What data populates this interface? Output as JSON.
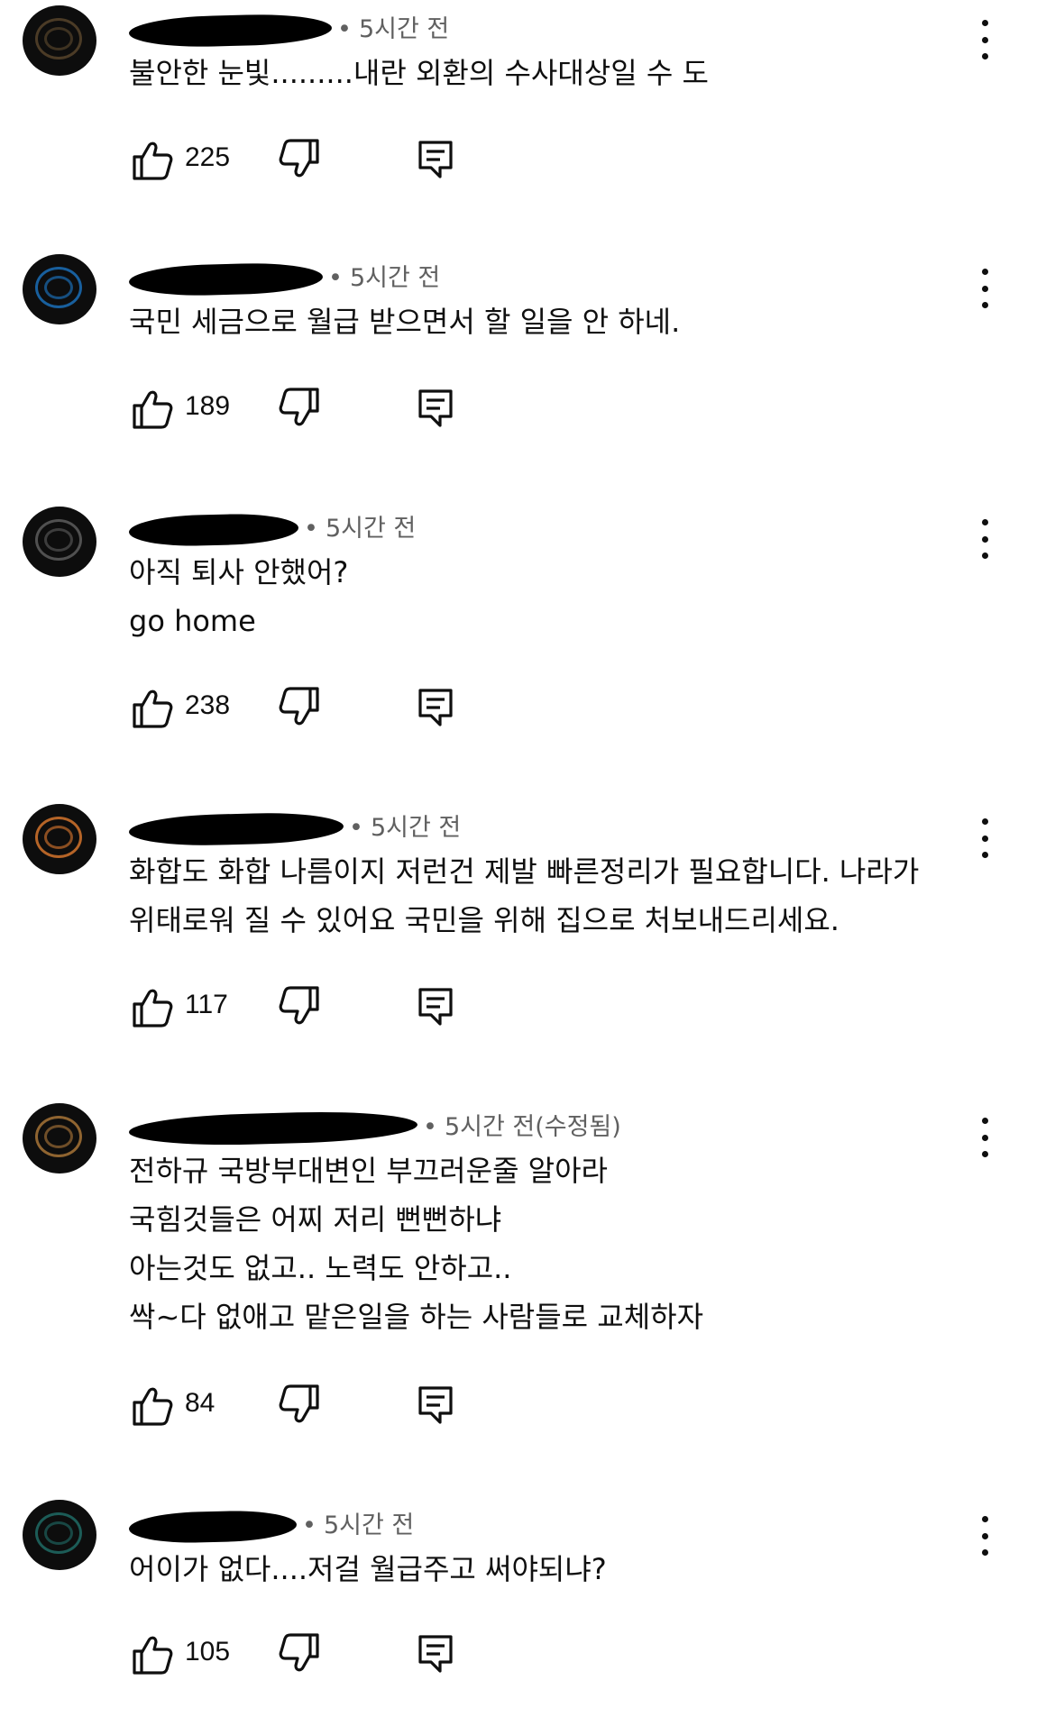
{
  "comments": [
    {
      "time": "5시간 전",
      "lines": [
        "불안한 눈빛.........내란 외환의 수사대상일 수 도"
      ],
      "likes": "225",
      "avatar_color": "#c89a5a"
    },
    {
      "time": "5시간 전",
      "lines": [
        "국민 세금으로 월급 받으면서 할 일을 안 하네."
      ],
      "likes": "189",
      "avatar_color": "#1e88e5"
    },
    {
      "time": "5시간 전",
      "lines": [
        "아직 퇴사 안했어?",
        "go home"
      ],
      "likes": "238",
      "avatar_color": "#9e9e9e"
    },
    {
      "time": "5시간 전",
      "lines": [
        "화합도 화합 나름이지 저런건 제발 빠른정리가 필요합니다. 나라가",
        "위태로워 질 수 있어요 국민을 위해 집으로 처보내드리세요."
      ],
      "likes": "117",
      "avatar_color": "#e07a2e"
    },
    {
      "time": "5시간 전(수정됨)",
      "lines": [
        "전하규 국방부대변인 부끄러운줄 알아라",
        "국힘것들은 어찌 저리 뻔뻔하냐",
        "아는것도 없고.. 노력도 안하고..",
        "싹~다 없애고 맡은일을 하는 사람들로 교체하자"
      ],
      "likes": "84",
      "avatar_color": "#b07a3a"
    },
    {
      "time": "5시간 전",
      "lines": [
        "어이가 없다....저걸 월급주고 써야되냐?"
      ],
      "likes": "105",
      "avatar_color": "#2aa198"
    }
  ]
}
